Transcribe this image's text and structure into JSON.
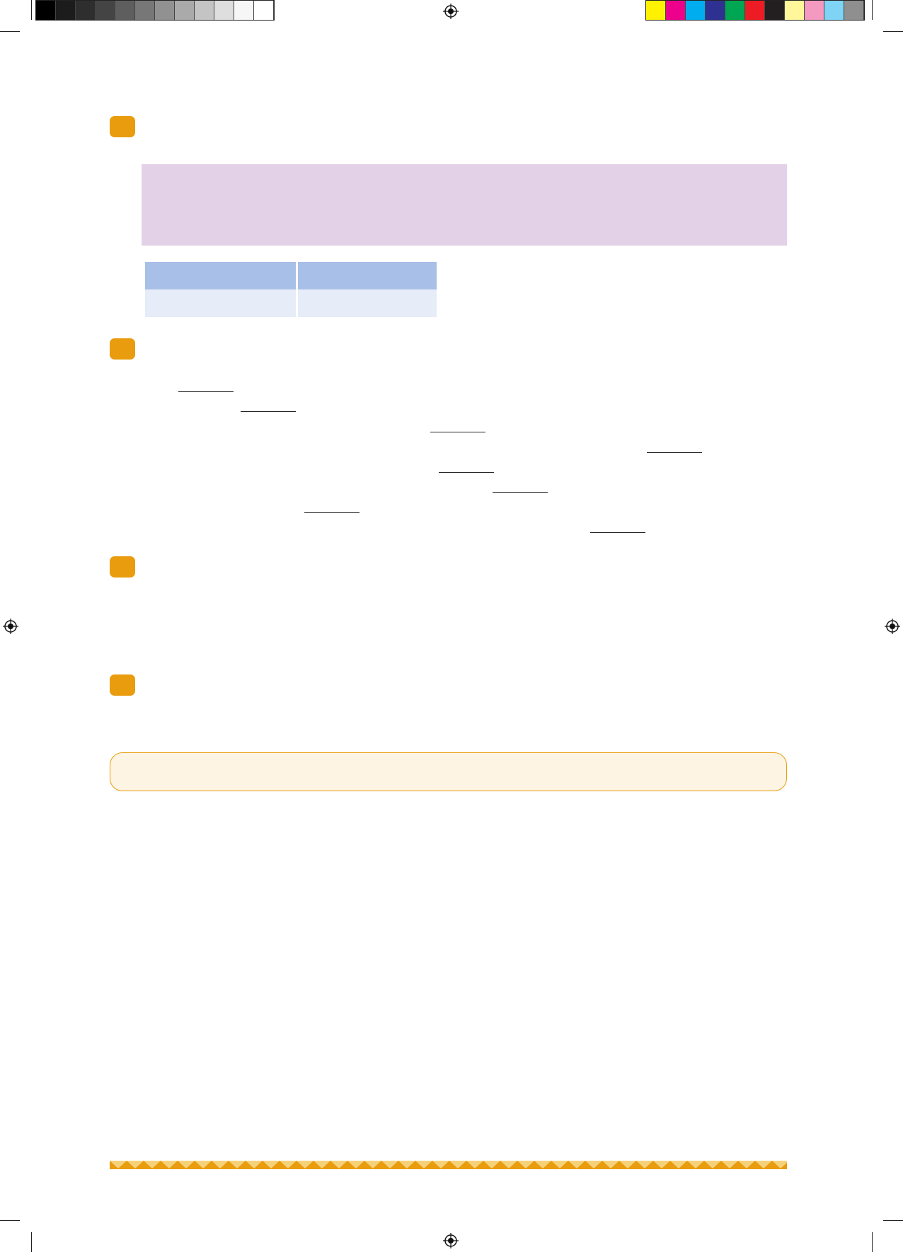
{
  "print_marks": {
    "gray_swatches": [
      "#000000",
      "#1c1c1c",
      "#2e2e2e",
      "#444444",
      "#5e5e5e",
      "#777777",
      "#919191",
      "#aaaaaa",
      "#c4c4c4",
      "#dedede",
      "#f6f6f6",
      "#ffffff"
    ],
    "color_swatches": [
      "#fff200",
      "#ec008c",
      "#00aeef",
      "#2e3192",
      "#00a651",
      "#ed1c24",
      "#231f20",
      "#fff799",
      "#f49ac1",
      "#7fd4f5",
      "#8f8f8f"
    ]
  },
  "colors": {
    "badge": "#e89c0e",
    "purple_box": "#e3d1e8",
    "table_header": "#a8bfe7",
    "table_body": "#e6ecf8",
    "note_border": "#e89c0e",
    "note_fill": "#fdf4e3",
    "footer_light": "#f5d27a",
    "footer_dark": "#e89c0e"
  },
  "sections": [
    {
      "name": "question-1"
    },
    {
      "name": "question-2",
      "answer_blanks": 8
    },
    {
      "name": "question-3"
    },
    {
      "name": "question-4"
    }
  ]
}
